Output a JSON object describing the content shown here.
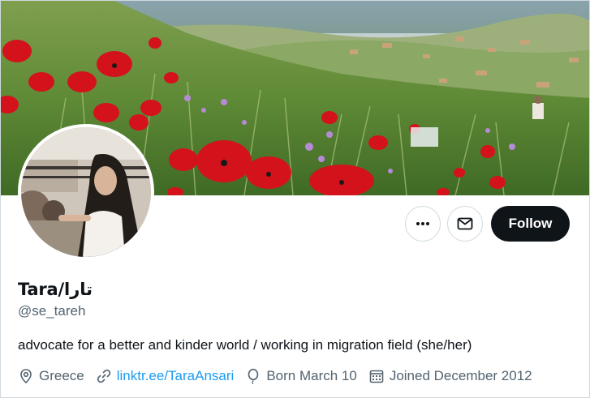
{
  "profile": {
    "display_name": "Tara/تارا",
    "handle": "@se_tareh",
    "bio": "advocate for a better and kinder world / working in migration field (she/her)"
  },
  "actions": {
    "follow_label": "Follow",
    "more_icon": "more-horizontal-icon",
    "message_icon": "envelope-icon"
  },
  "meta": {
    "location": "Greece",
    "website": "linktr.ee/TaraAnsari",
    "birthday": "Born March 10",
    "joined": "Joined December 2012",
    "icons": [
      "location-pin-icon",
      "link-icon",
      "balloon-icon",
      "calendar-icon"
    ]
  },
  "colors": {
    "text_primary": "#0f1419",
    "text_secondary": "#536471",
    "link": "#1d9bf0",
    "follow_bg": "#0f1419",
    "border": "#cfd9de"
  }
}
